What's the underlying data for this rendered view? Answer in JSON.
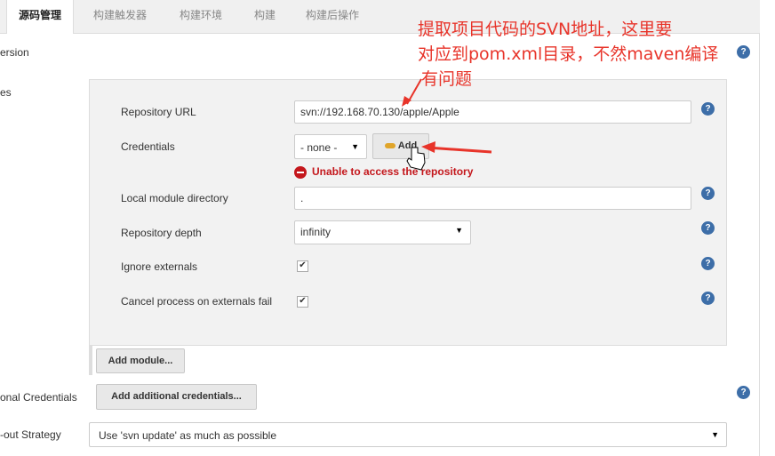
{
  "tabs": [
    {
      "label": "源码管理"
    },
    {
      "label": "构建触发器"
    },
    {
      "label": "构建环境"
    },
    {
      "label": "构建"
    },
    {
      "label": "构建后操作"
    }
  ],
  "left_labels": {
    "version": "ersion",
    "modules": "es",
    "additional_credentials": "onal Credentials",
    "checkout_strategy": "-out Strategy"
  },
  "module": {
    "repository_url": {
      "label": "Repository URL",
      "value": "svn://192.168.70.130/apple/Apple"
    },
    "credentials": {
      "label": "Credentials",
      "selected": "- none -",
      "add_label": "Add"
    },
    "error_text": "Unable to access the repository",
    "local_module_directory": {
      "label": "Local module directory",
      "value": "."
    },
    "repository_depth": {
      "label": "Repository depth",
      "selected": "infinity"
    },
    "ignore_externals": {
      "label": "Ignore externals",
      "checked": true
    },
    "cancel_process": {
      "label": "Cancel process on externals fail",
      "checked": true
    },
    "add_module_label": "Add module..."
  },
  "additional_credentials_button": "Add additional credentials...",
  "checkout_strategy_selected": "Use 'svn update' as much as possible",
  "annotation": {
    "line1": "提取项目代码的SVN地址，这里要",
    "line2": "对应到pom.xml目录，不然maven编译",
    "line3": "有问题",
    "color": "#e8342a"
  },
  "icons": {
    "help": "help-icon",
    "error": "error-icon",
    "key": "key-icon",
    "checkmark": "checkmark-icon",
    "dropdown": "dropdown-arrow-icon",
    "cursor": "hand-cursor-icon"
  },
  "colors": {
    "tab_bar": "#f0f0f0",
    "panel": "#f2f2f2",
    "help": "#3d6ea8",
    "error": "#c4171c"
  }
}
